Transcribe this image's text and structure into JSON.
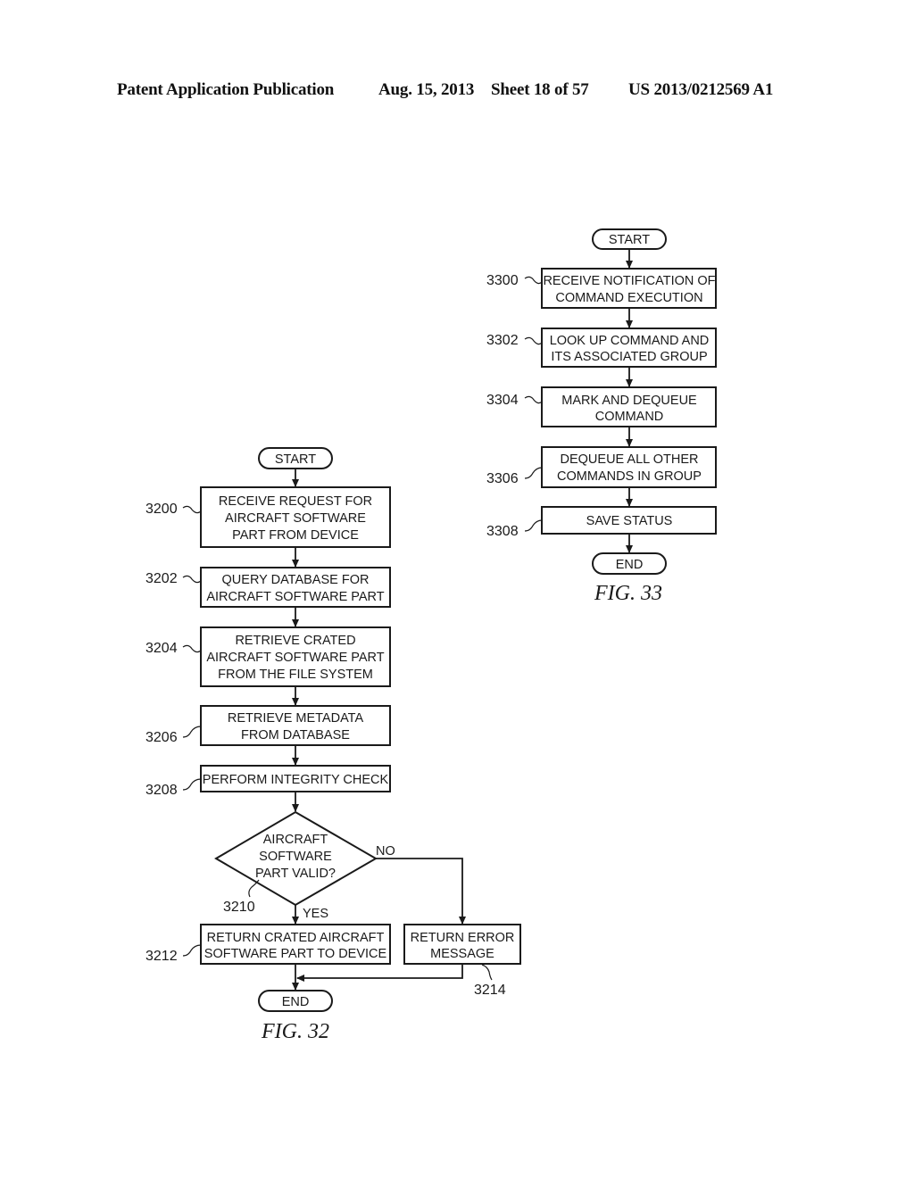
{
  "header": {
    "publication": "Patent Application Publication",
    "date": "Aug. 15, 2013",
    "sheet": "Sheet 18 of 57",
    "number": "US 2013/0212569 A1"
  },
  "fig32": {
    "caption": "FIG. 32",
    "start": "START",
    "end": "END",
    "steps": [
      {
        "ref": "3200",
        "lines": [
          "RECEIVE REQUEST FOR",
          "AIRCRAFT SOFTWARE",
          "PART FROM DEVICE"
        ]
      },
      {
        "ref": "3202",
        "lines": [
          "QUERY DATABASE FOR",
          "AIRCRAFT SOFTWARE PART"
        ]
      },
      {
        "ref": "3204",
        "lines": [
          "RETRIEVE CRATED",
          "AIRCRAFT SOFTWARE PART",
          "FROM THE FILE SYSTEM"
        ]
      },
      {
        "ref": "3206",
        "lines": [
          "RETRIEVE METADATA",
          "FROM DATABASE"
        ]
      },
      {
        "ref": "3208",
        "lines": [
          "PERFORM INTEGRITY CHECK"
        ]
      }
    ],
    "decision": {
      "ref": "3210",
      "lines": [
        "AIRCRAFT",
        "SOFTWARE",
        "PART VALID?"
      ],
      "yes": "YES",
      "no": "NO"
    },
    "yes_step": {
      "ref": "3212",
      "lines": [
        "RETURN CRATED AIRCRAFT",
        "SOFTWARE PART TO DEVICE"
      ]
    },
    "no_step": {
      "ref": "3214",
      "lines": [
        "RETURN ERROR",
        "MESSAGE"
      ]
    }
  },
  "fig33": {
    "caption": "FIG. 33",
    "start": "START",
    "end": "END",
    "steps": [
      {
        "ref": "3300",
        "lines": [
          "RECEIVE NOTIFICATION OF",
          "COMMAND EXECUTION"
        ]
      },
      {
        "ref": "3302",
        "lines": [
          "LOOK UP COMMAND AND",
          "ITS ASSOCIATED GROUP"
        ]
      },
      {
        "ref": "3304",
        "lines": [
          "MARK AND DEQUEUE",
          "COMMAND"
        ]
      },
      {
        "ref": "3306",
        "lines": [
          "DEQUEUE ALL OTHER",
          "COMMANDS IN GROUP"
        ]
      },
      {
        "ref": "3308",
        "lines": [
          "SAVE STATUS"
        ]
      }
    ]
  }
}
